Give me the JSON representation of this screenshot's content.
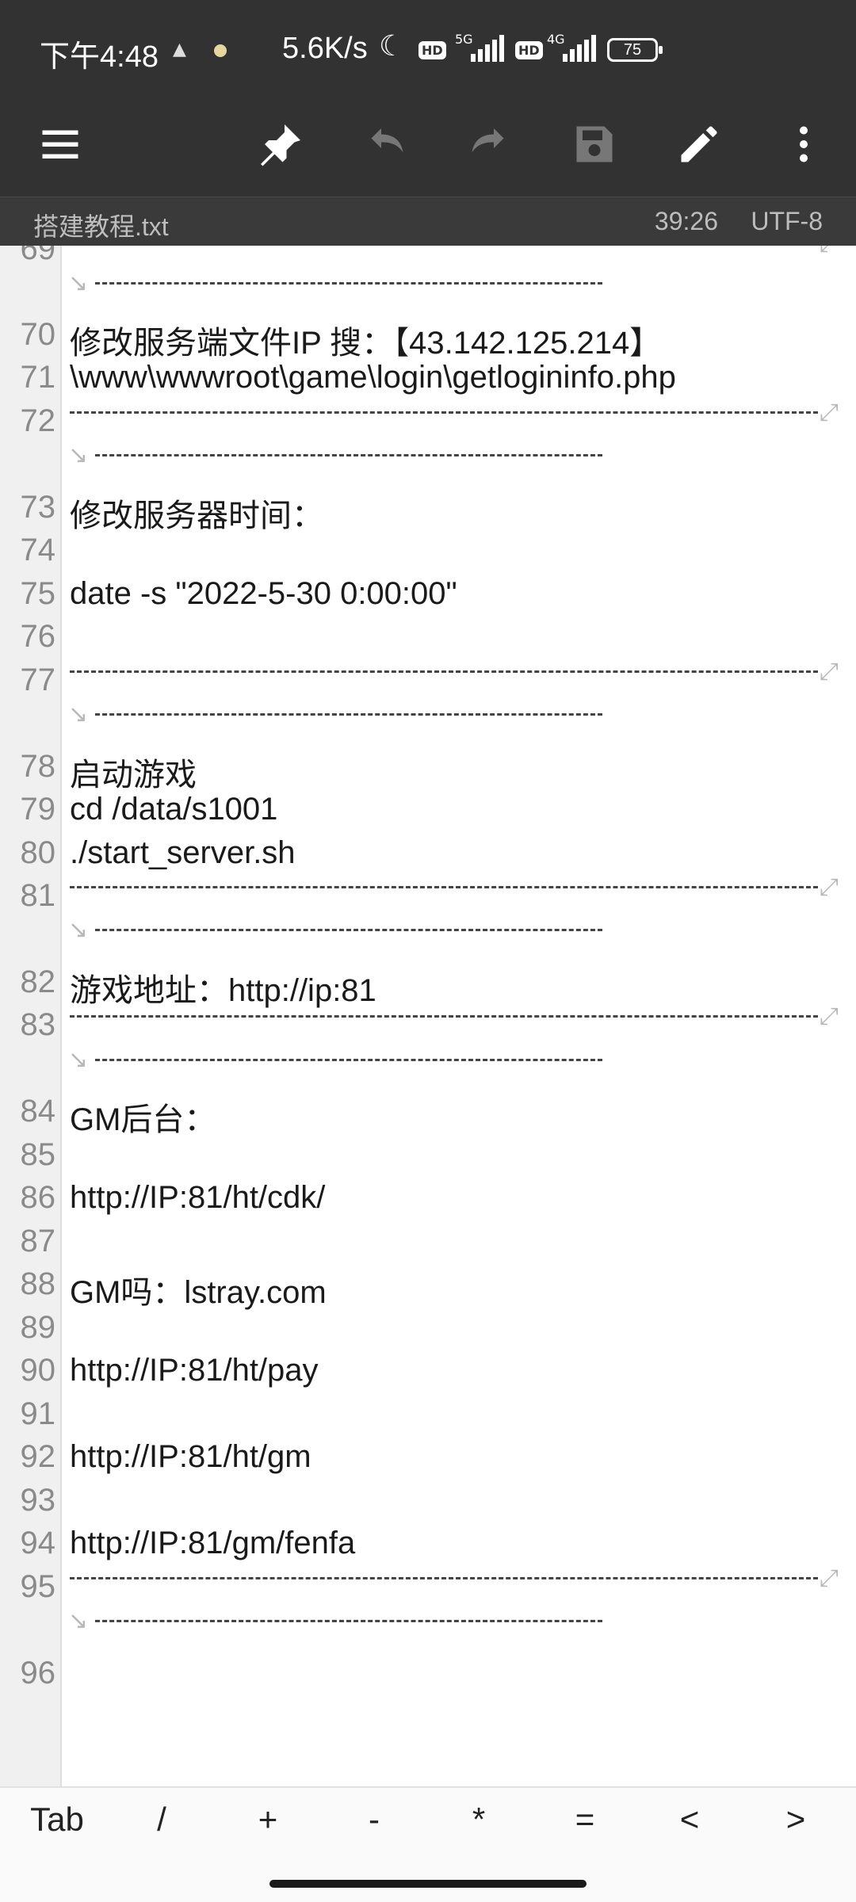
{
  "status_bar": {
    "time": "下午4:48",
    "speed": "5.6K/s",
    "net1": "5G",
    "net2": "4G",
    "hd": "HD",
    "battery": "75"
  },
  "toolbar": {
    "menu_icon": "menu-icon",
    "pin_icon": "pin-icon",
    "undo_icon": "undo-icon",
    "redo_icon": "redo-icon",
    "save_icon": "save-icon",
    "edit_icon": "edit-icon",
    "more_icon": "more-vert-icon"
  },
  "file_bar": {
    "filename": "搭建教程.txt",
    "cursor_position": "39:26",
    "encoding": "UTF-8"
  },
  "editor": {
    "partial_line_number": "69",
    "lines": [
      {
        "num": "70",
        "text": "修改服务端文件IP   搜：【43.142.125.214】"
      },
      {
        "num": "71",
        "text": "\\www\\wwwroot\\game\\login\\getlogininfo.php"
      },
      {
        "num": "72",
        "text": ""
      },
      {
        "num": "73",
        "text": "修改服务器时间："
      },
      {
        "num": "74",
        "text": ""
      },
      {
        "num": "75",
        "text": "date  -s  \"2022-5-30  0:00:00\""
      },
      {
        "num": "76",
        "text": ""
      },
      {
        "num": "77",
        "text": ""
      },
      {
        "num": "78",
        "text": "启动游戏"
      },
      {
        "num": "79",
        "text": "cd  /data/s1001"
      },
      {
        "num": "80",
        "text": "./start_server.sh"
      },
      {
        "num": "81",
        "text": ""
      },
      {
        "num": "82",
        "text": "游戏地址：http://ip:81"
      },
      {
        "num": "83",
        "text": ""
      },
      {
        "num": "84",
        "text": "GM后台："
      },
      {
        "num": "85",
        "text": ""
      },
      {
        "num": "86",
        "text": "http://IP:81/ht/cdk/"
      },
      {
        "num": "87",
        "text": ""
      },
      {
        "num": "88",
        "text": "GM吗：lstray.com"
      },
      {
        "num": "89",
        "text": ""
      },
      {
        "num": "90",
        "text": "http://IP:81/ht/pay"
      },
      {
        "num": "91",
        "text": ""
      },
      {
        "num": "92",
        "text": "http://IP:81/ht/gm"
      },
      {
        "num": "93",
        "text": ""
      },
      {
        "num": "94",
        "text": "http://IP:81/gm/fenfa"
      },
      {
        "num": "95",
        "text": ""
      },
      {
        "num": "96",
        "text": ""
      }
    ]
  },
  "symbol_bar": {
    "keys": [
      "Tab",
      "/",
      "+",
      "-",
      "*",
      "=",
      "<",
      ">"
    ]
  }
}
